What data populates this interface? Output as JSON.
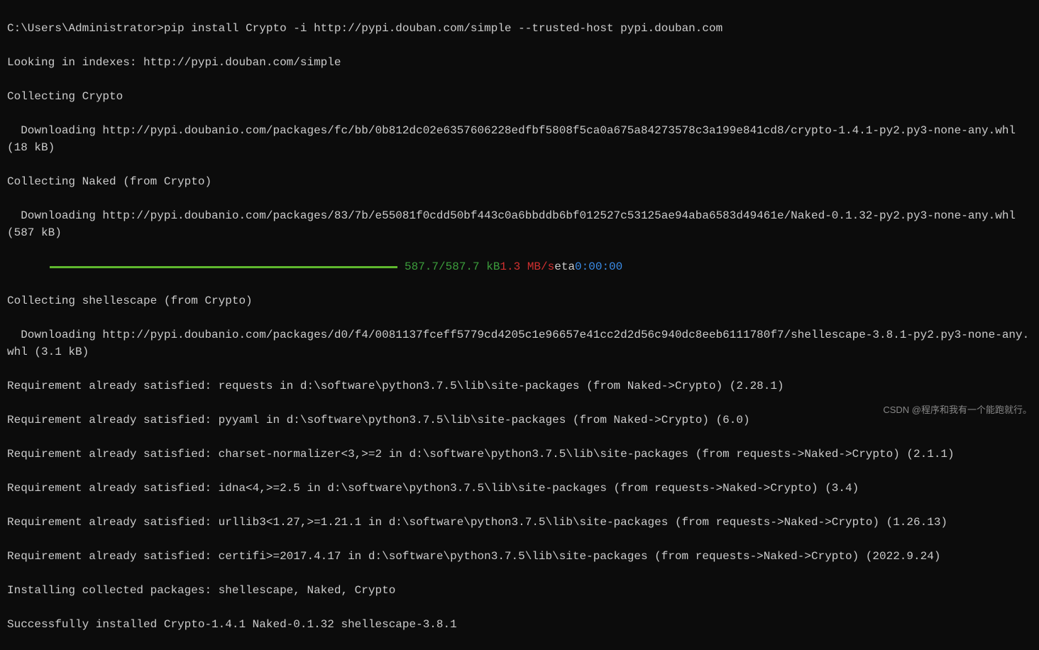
{
  "terminal": {
    "prompt": "C:\\Users\\Administrator>",
    "command": "pip install Crypto -i http://pypi.douban.com/simple --trusted-host pypi.douban.com",
    "lines": {
      "looking": "Looking in indexes: http://pypi.douban.com/simple",
      "collecting_crypto": "Collecting Crypto",
      "downloading_crypto": "  Downloading http://pypi.doubanio.com/packages/fc/bb/0b812dc02e6357606228edfbf5808f5ca0a675a84273578c3a199e841cd8/crypto-1.4.1-py2.py3-none-any.whl (18 kB)",
      "collecting_naked": "Collecting Naked (from Crypto)",
      "downloading_naked": "  Downloading http://pypi.doubanio.com/packages/83/7b/e55081f0cdd50bf443c0a6bbddb6bf012527c53125ae94aba6583d49461e/Naked-0.1.32-py2.py3-none-any.whl (587 kB)",
      "collecting_shellescape": "Collecting shellescape (from Crypto)",
      "downloading_shellescape": "  Downloading http://pypi.doubanio.com/packages/d0/f4/0081137fceff5779cd4205c1e96657e41cc2d2d56c940dc8eeb6111780f7/shellescape-3.8.1-py2.py3-none-any.whl (3.1 kB)",
      "req_requests": "Requirement already satisfied: requests in d:\\software\\python3.7.5\\lib\\site-packages (from Naked->Crypto) (2.28.1)",
      "req_pyyaml": "Requirement already satisfied: pyyaml in d:\\software\\python3.7.5\\lib\\site-packages (from Naked->Crypto) (6.0)",
      "req_charset": "Requirement already satisfied: charset-normalizer<3,>=2 in d:\\software\\python3.7.5\\lib\\site-packages (from requests->Naked->Crypto) (2.1.1)",
      "req_idna": "Requirement already satisfied: idna<4,>=2.5 in d:\\software\\python3.7.5\\lib\\site-packages (from requests->Naked->Crypto) (3.4)",
      "req_urllib3": "Requirement already satisfied: urllib3<1.27,>=1.21.1 in d:\\software\\python3.7.5\\lib\\site-packages (from requests->Naked->Crypto) (1.26.13)",
      "req_certifi": "Requirement already satisfied: certifi>=2017.4.17 in d:\\software\\python3.7.5\\lib\\site-packages (from requests->Naked->Crypto) (2022.9.24)",
      "installing": "Installing collected packages: shellescape, Naked, Crypto",
      "success": "Successfully installed Crypto-1.4.1 Naked-0.1.32 shellescape-3.8.1"
    },
    "progress": {
      "size": "587.7/587.7 kB",
      "speed": "1.3 MB/s",
      "eta_label": "eta",
      "eta_time": "0:00:00"
    }
  },
  "watermark": "CSDN @程序和我有一个能跑就行。"
}
